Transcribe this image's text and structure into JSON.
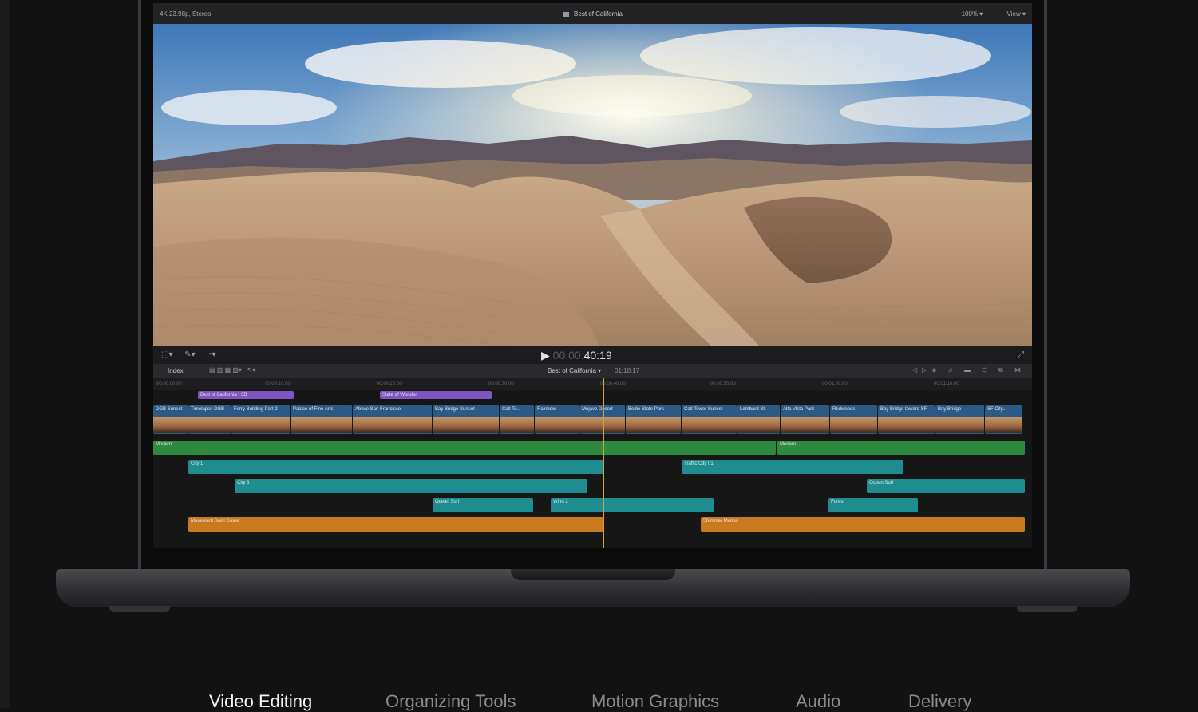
{
  "app": {
    "format_info": "4K 23.98p, Stereo",
    "project_title": "Best of California",
    "zoom": "100%",
    "view_menu": "View"
  },
  "viewer": {
    "timecode_dim": "00:00:",
    "timecode": "40:19"
  },
  "timeline": {
    "index_label": "Index",
    "project_menu": "Best of California",
    "duration": "01:18:17",
    "ruler": [
      "00:00:00:00",
      "00:00:10:00",
      "00:00:20:00",
      "00:00:30:00",
      "00:00:40:00",
      "00:00:50:00",
      "00:01:00:00",
      "00:01:10:00"
    ],
    "titles": [
      "Best of California - 3D",
      "State of Wonder"
    ],
    "video_clips": [
      "DGB Sunset",
      "Timelapse DGB",
      "Ferry Building Part 2",
      "Palace of Fine Arts",
      "Above San Francisco",
      "Bay Bridge Sunset",
      "Coit To...",
      "Rainbow",
      "Mojave Desert",
      "Bodie State Park",
      "Coit Tower Sunset",
      "Lombard St.",
      "Alta Vista Park",
      "Redwoods",
      "Bay Bridge toward SF",
      "Bay Bridge",
      "SF City..."
    ],
    "music": [
      "Modern",
      "Modern"
    ],
    "audio_clips": [
      "City 1",
      "Traffic City 01",
      "City 3",
      "Ocean Surf",
      "Ocean Surf",
      "Wind 2",
      "Forest",
      "Movement Swirl Drone",
      "Shimmer Motion"
    ]
  },
  "nav": {
    "items": [
      "Video Editing",
      "Organizing Tools",
      "Motion Graphics",
      "Audio",
      "Delivery"
    ],
    "active_index": 0
  },
  "colors": {
    "page_bg": "#121212",
    "title_clip": "#7e56c2",
    "video_clip": "#2b5a86",
    "music_clip": "#2e8a3e",
    "audio_clip": "#1f8c8f",
    "effects_clip": "#c97a1f",
    "playhead": "#d1a33a"
  }
}
